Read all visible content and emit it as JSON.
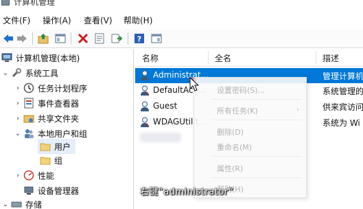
{
  "window": {
    "title": "计算机管理"
  },
  "menu": {
    "file": "文件(F)",
    "action": "操作(A)",
    "view": "查看(V)",
    "help": "帮助(H)"
  },
  "toolbar": {
    "icons": [
      "back-arrow-icon",
      "forward-arrow-icon",
      "up-folder-icon",
      "show-hide-tree-icon",
      "delete-icon",
      "properties-icon",
      "export-list-icon",
      "help-icon",
      "show-hide-action-pane-icon"
    ]
  },
  "tree": {
    "root": "计算机管理(本地)",
    "system_tools": "系统工具",
    "task_scheduler": "任务计划程序",
    "event_viewer": "事件查看器",
    "shared_folders": "共享文件夹",
    "local_users_groups": "本地用户和组",
    "users": "用户",
    "groups": "组",
    "performance": "性能",
    "device_manager": "设备管理器",
    "storage": "存储"
  },
  "list": {
    "columns": {
      "name": "名称",
      "full_name": "全名",
      "description": "描述"
    },
    "rows": [
      {
        "name": "Administrat...",
        "description": "管理计算机"
      },
      {
        "name": "DefaultAcc...",
        "description": "系统管理的"
      },
      {
        "name": "Guest",
        "description": "供来宾访问"
      },
      {
        "name": "WDAGUtilit...",
        "description": "系统为 Wi"
      }
    ]
  },
  "context_menu": {
    "set_password": "设置密码(S)...",
    "all_tasks": "所有任务(K)",
    "delete": "删除(D)",
    "rename": "重命名(M)",
    "properties": "属性(R)",
    "help": "帮助(H)"
  },
  "caption": "右键“administrator”",
  "colors": {
    "selection": "#0078d7",
    "tree_selection": "#e5eef9"
  }
}
